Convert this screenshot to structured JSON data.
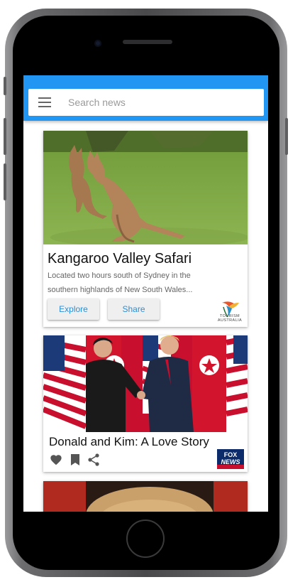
{
  "search": {
    "placeholder": "Search news",
    "value": ""
  },
  "cards": [
    {
      "title": "Kangaroo Valley Safari",
      "description": "Located two hours south of Sydney in the southern highlands of New South Wales...",
      "actions": [
        "Explore",
        "Share"
      ],
      "logo_text": [
        "TOURISM",
        "AUSTRALIA"
      ]
    },
    {
      "title": "Donald and Kim: A Love Story",
      "icons": [
        "heart-icon",
        "bookmark-icon",
        "share-icon"
      ],
      "logo_text": [
        "FOX",
        "NEWS"
      ]
    }
  ],
  "colors": {
    "app_bar": "#2196f3",
    "button_text": "#2b8fd6"
  }
}
